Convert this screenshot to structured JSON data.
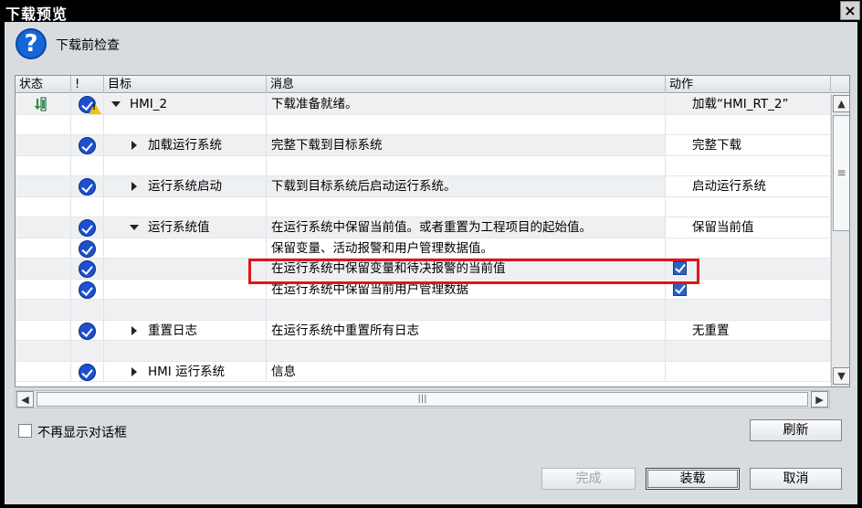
{
  "window": {
    "title": "下载预览",
    "close_glyph": "×"
  },
  "header": {
    "icon": "question-icon",
    "icon_glyph": "?",
    "title": "下载前检查"
  },
  "columns": {
    "status": "状态",
    "bang": "!",
    "target": "目标",
    "message": "消息",
    "action": "动作"
  },
  "rows": [
    {
      "target": "HMI_2",
      "message": "下载准备就绪。",
      "action": "加载“HMI_RT_2”"
    },
    {
      "target": "",
      "message": "",
      "action": ""
    },
    {
      "target": "加载运行系统",
      "message": "完整下载到目标系统",
      "action": "完整下载"
    },
    {
      "target": "",
      "message": "",
      "action": ""
    },
    {
      "target": "运行系统启动",
      "message": "下载到目标系统后启动运行系统。",
      "action": "启动运行系统"
    },
    {
      "target": "",
      "message": "",
      "action": ""
    },
    {
      "target": "运行系统值",
      "message": "在运行系统中保留当前值。或者重置为工程项目的起始值。",
      "action": "保留当前值"
    },
    {
      "target": "",
      "message": "保留变量、活动报警和用户管理数据值。",
      "action": ""
    },
    {
      "target": "",
      "message": "在运行系统中保留变量和待决报警的当前值",
      "action": ""
    },
    {
      "target": "",
      "message": "在运行系统中保留当前用户管理数据",
      "action": ""
    },
    {
      "target": "",
      "message": "",
      "action": ""
    },
    {
      "target": "重置日志",
      "message": "在运行系统中重置所有日志",
      "action": "无重置"
    },
    {
      "target": "",
      "message": "",
      "action": ""
    },
    {
      "target": "HMI 运行系统",
      "message": "信息",
      "action": ""
    }
  ],
  "scrollbars": {
    "up": "▲",
    "down": "▼",
    "left": "◀",
    "right": "▶",
    "v_grip": "≡",
    "h_grip": "|||"
  },
  "footer": {
    "dont_show_label": "不再显示对话框",
    "refresh": "刷新",
    "finish": "完成",
    "load": "装载",
    "cancel": "取消"
  },
  "colors": {
    "highlight": "#e3131b",
    "ok": "#1d4fd0",
    "checkbox": "#2a64c4"
  }
}
